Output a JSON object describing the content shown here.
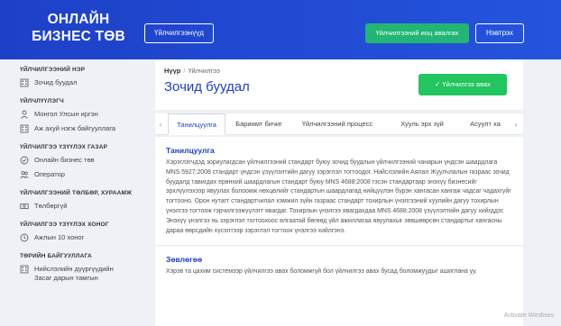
{
  "header": {
    "logo": "ОНЛАЙН БИЗНЕС ТӨВ",
    "services_button": "Үйлчилгээнүүд",
    "request_button": "Үйлчилгээний иоц авалгах",
    "login_button": "Нэвтрэх",
    "bg_color": "#1e40c8",
    "accent_color": "#22b573"
  },
  "sidebar": {
    "sections": [
      {
        "heading": "ҮЙЛЧИЛГЭЭНИЙ НЭР",
        "items": [
          {
            "icon": "building-icon",
            "label": "Зочид буудал"
          }
        ]
      },
      {
        "heading": "ҮЙЛЧЛҮҮЛЭГЧ",
        "items": [
          {
            "icon": "person-icon",
            "label": "Монгол Улсын иргэн"
          },
          {
            "icon": "building-icon",
            "label": "Аж ахуй нэгж байгууллага"
          }
        ]
      },
      {
        "heading": "ҮЙЛЧИЛГЭЭ ҮЗҮҮЛЭХ ГАЗАР",
        "items": [
          {
            "icon": "check-circle-icon",
            "label": "Онлайн бизнес төв"
          },
          {
            "icon": "users-icon",
            "label": "Оператор"
          }
        ]
      },
      {
        "heading": "ҮЙЛЧИЛГЭЭНИЙ ТӨЛБӨР, ХУРААМЖ",
        "items": [
          {
            "icon": "money-icon",
            "label": "Төлбөргүй"
          }
        ]
      },
      {
        "heading": "ҮЙЛЧИЛГЭЭ ҮЗҮҮЛЭХ ХОНОГ",
        "items": [
          {
            "icon": "clock-icon",
            "label": "Ажлын 10 хоног"
          }
        ]
      },
      {
        "heading": "ТӨРИЙН БАЙГУУЛЛАГА",
        "items": [
          {
            "icon": "building-icon",
            "label": "Нийслэлийн дүүргүүдийн Засаг дарын тамгын"
          }
        ]
      }
    ]
  },
  "main": {
    "breadcrumb_home": "Нүүр",
    "breadcrumb_current": "Үйлчилгээ",
    "title": "Зочид буудал",
    "request_button": "✓ Үйлчилгээ авах",
    "tabs": [
      "Танилцуулга",
      "Бариимт бичиг",
      "Үйлчилгээний процесс",
      "Хууль эрх зүй",
      "Асуулт ха"
    ],
    "section1_title": "Танилцуулга",
    "section1_text": "Хэрэглэгчдэд зориулагдсан үйлчилгээний стандарт буюу зочид буудлын үйлчилгээний чанарын үндсэн шаардлага MNS 5927:2008 стандарт үндсэн үзүүлэлтийн дагуу зэрэглэл тогтоодог. Нийслэлийн Аялал Жуулчлалын газраас зочид буудалд тавигдах ерөнхий шаардлагын стандарт буюу MNS 4688:2008 гэсэн стандартаар энэхүү бизнесийг эрхлүүлэхээр явуулах болоомж нөхцөлийг стандартын шаардлагад нийцүүлэн бүрэн хангасан хангаж чадсаг чадахгүйг тогтооно. Орон нутагт стандартчилал хэмжил зүйн газраас стандарт тохирлын үнэлгээний хуулийн дагуу тохирлын үнэлгээ тогтоож гэрчилгээжүүлэгт явагдаг. Тохирлын үнэлгээ явагдахдаа MNS 4688:2008 үзүүлэлтийн дагуу хийгддэг. Энэхүү үнэлгээ нь зэрэглэл тогтоохоос өлгаатай бөгөөд үйл ажиллагаа явуулахыг зөвшөөрсөн стандартыг хангасны дараа өөрсдийн хүсэлтээр зэрэглэл тогтоох үнэлгээ хийлгэнэ.",
    "section2_title": "Зөвлөгөө",
    "section2_text": "Хэрэв та цахим системээр үйлчилгээ авах боломжгүй бол үйлчилгээ авах бусад боломжуудыг ашиглана уу.",
    "watermark": "Activate Windows"
  }
}
